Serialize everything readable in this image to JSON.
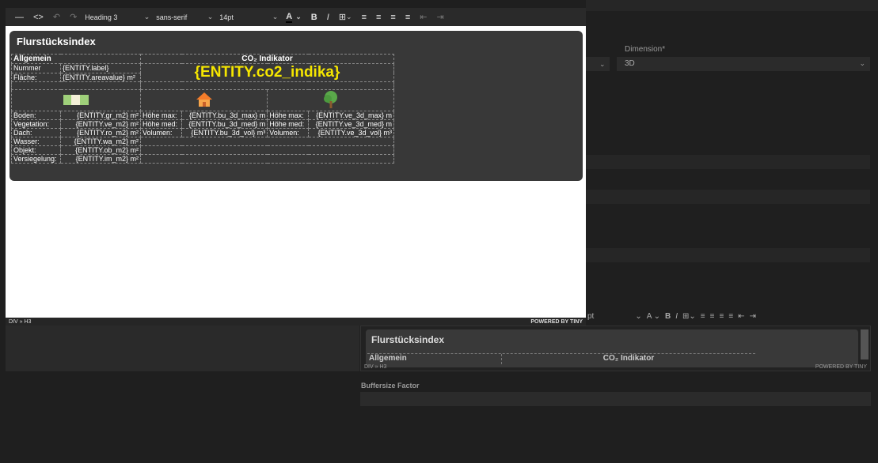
{
  "toolbar": {
    "block_format": "Heading 3",
    "font_family": "sans-serif",
    "font_size": "14pt",
    "text_color_label": "A",
    "bold_label": "B",
    "italic_label": "I"
  },
  "editor": {
    "card_title": "Flurstücksindex",
    "table": {
      "section_general": "Allgemein",
      "section_co2": "CO₂ Indikator",
      "nummer_label": "Nummer",
      "nummer_value": "{ENTITY.label}",
      "flaeche_label": "Fläche:",
      "flaeche_value": "{ENTITY.areavalue} m²",
      "co2_value": "{ENTITY.co2_indika}",
      "rows": [
        {
          "label": "Boden:",
          "value": "{ENTITY.gr_m2} m²",
          "b_label": "Höhe max:",
          "b_value": "{ENTITY.bu_3d_max} m",
          "v_label": "Höhe max:",
          "v_value": "{ENTITY.ve_3d_max} m"
        },
        {
          "label": "Vegetation:",
          "value": "{ENTITY.ve_m2} m²",
          "b_label": "Höhe med:",
          "b_value": "{ENTITY.bu_3d_med} m",
          "v_label": "Höhe med:",
          "v_value": "{ENTITY.ve_3d_med} m"
        },
        {
          "label": "Dach:",
          "value": "{ENTITY.ro_m2} m²",
          "b_label": "Volumen:",
          "b_value": "{ENTITY.bu_3d_vol} m³",
          "v_label": "Volumen:",
          "v_value": "{ENTITY.ve_3d_vol} m³"
        },
        {
          "label": "Wasser:",
          "value": "{ENTITY.wa_m2} m²"
        },
        {
          "label": "Objekt:",
          "value": "{ENTITY.ob_m2} m²"
        },
        {
          "label": "Versiegelung:",
          "value": "{ENTITY.im_m2} m²"
        }
      ]
    },
    "status_path": "DIV » H3",
    "powered_by": "POWERED BY TINY"
  },
  "background": {
    "dimension_label": "Dimension*",
    "dimension_value": "3D",
    "font_size_partial": "pt",
    "mini_title": "Flurstücksindex",
    "mini_general": "Allgemein",
    "mini_co2": "CO₂ Indikator",
    "mini_status_path": "DIV » H3",
    "mini_powered_by": "POWERED BY TINY",
    "buffersize_label": "Buffersize Factor"
  },
  "colors": {
    "accent_yellow": "#f5e600",
    "card_bg": "#383838",
    "app_bg": "#1f1f1f"
  }
}
